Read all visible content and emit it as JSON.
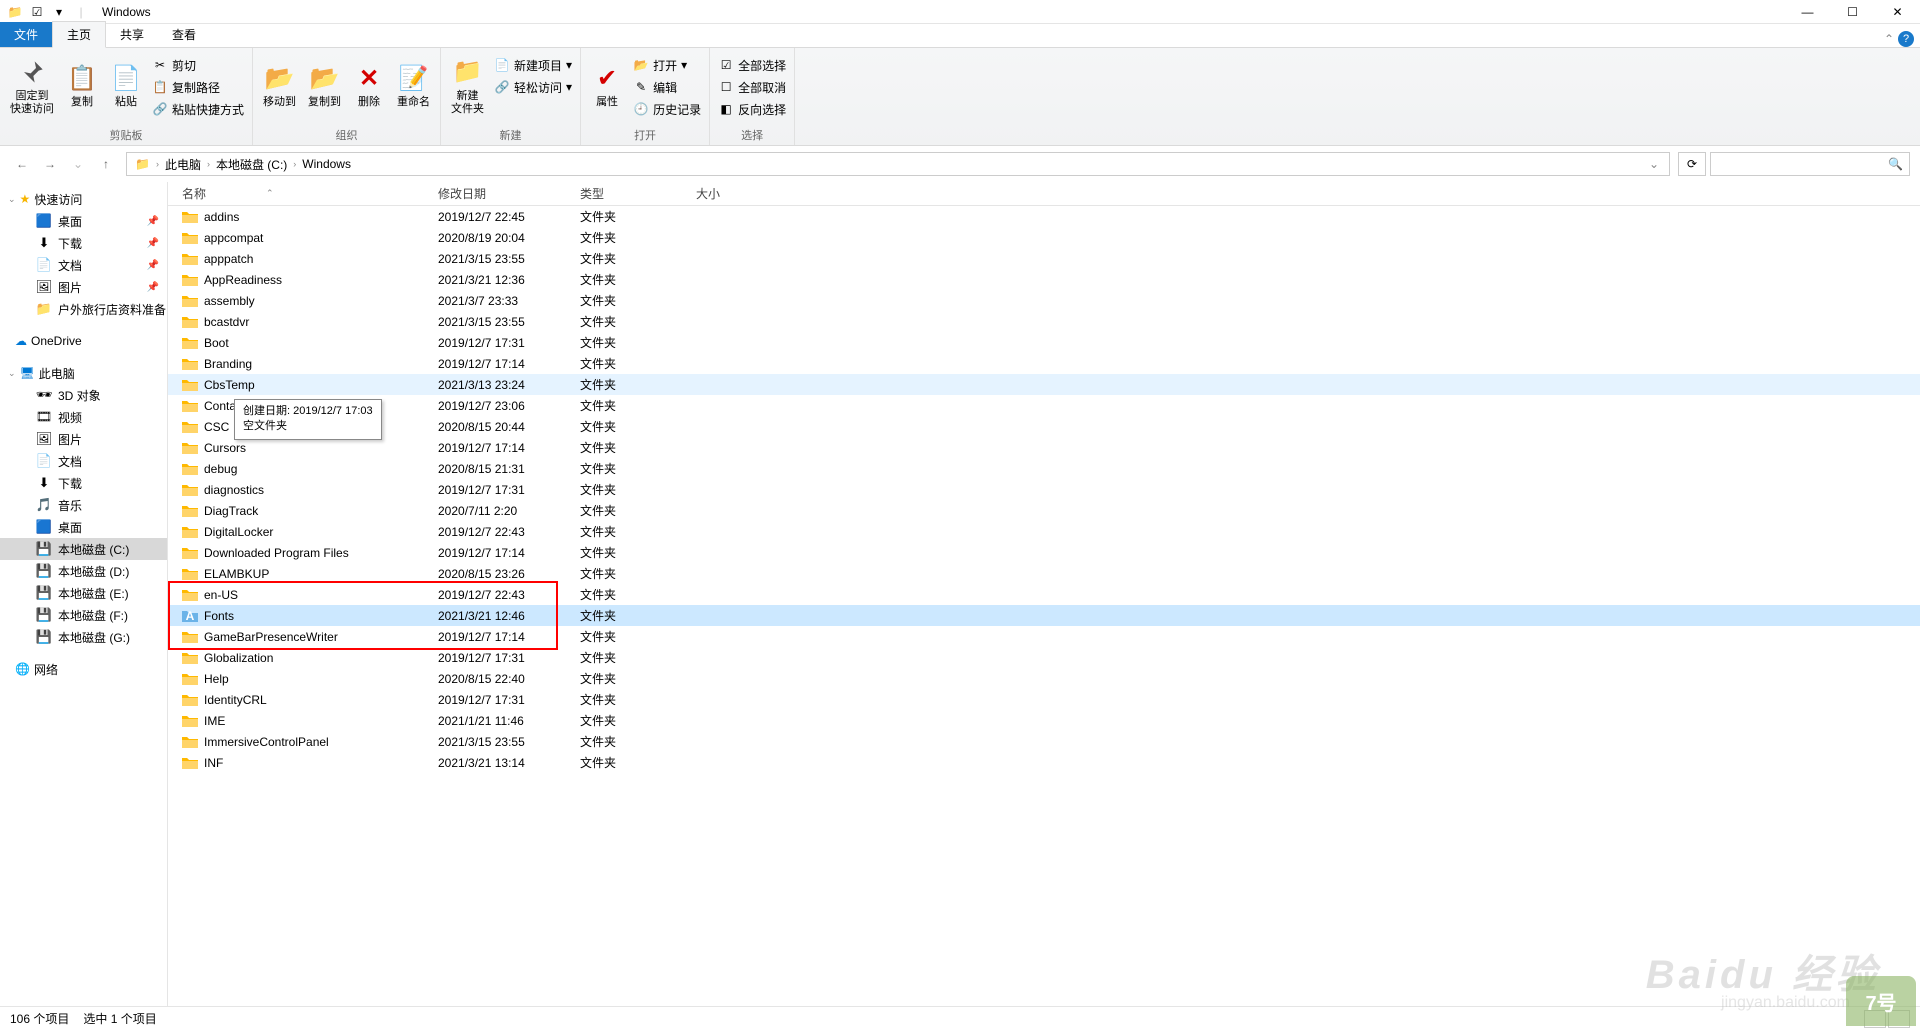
{
  "window": {
    "title": "Windows",
    "minimize": "—",
    "maximize": "☐",
    "close": "✕"
  },
  "tabs": {
    "file": "文件",
    "home": "主页",
    "share": "共享",
    "view": "查看"
  },
  "ribbon": {
    "clipboard": {
      "label": "剪贴板",
      "pin": "固定到\n快速访问",
      "copy": "复制",
      "paste": "粘贴",
      "cut": "剪切",
      "copy_path": "复制路径",
      "paste_shortcut": "粘贴快捷方式"
    },
    "organize": {
      "label": "组织",
      "move_to": "移动到",
      "copy_to": "复制到",
      "delete": "删除",
      "rename": "重命名"
    },
    "new": {
      "label": "新建",
      "new_folder": "新建\n文件夹",
      "new_item": "新建项目",
      "easy_access": "轻松访问"
    },
    "open": {
      "label": "打开",
      "properties": "属性",
      "open": "打开",
      "edit": "编辑",
      "history": "历史记录"
    },
    "select": {
      "label": "选择",
      "select_all": "全部选择",
      "select_none": "全部取消",
      "invert": "反向选择"
    }
  },
  "breadcrumbs": [
    "此电脑",
    "本地磁盘 (C:)",
    "Windows"
  ],
  "columns": {
    "name": "名称",
    "date": "修改日期",
    "type": "类型",
    "size": "大小"
  },
  "sidebar": {
    "quick_access": "快速访问",
    "quick_items": [
      {
        "icon": "🟦",
        "label": "桌面",
        "pinned": true
      },
      {
        "icon": "⬇",
        "label": "下载",
        "pinned": true
      },
      {
        "icon": "📄",
        "label": "文档",
        "pinned": true
      },
      {
        "icon": "🖼",
        "label": "图片",
        "pinned": true
      },
      {
        "icon": "📁",
        "label": "户外旅行店资料准备",
        "pinned": false
      }
    ],
    "onedrive": "OneDrive",
    "this_pc": "此电脑",
    "pc_items": [
      {
        "icon": "🕶",
        "label": "3D 对象"
      },
      {
        "icon": "🎞",
        "label": "视频"
      },
      {
        "icon": "🖼",
        "label": "图片"
      },
      {
        "icon": "📄",
        "label": "文档"
      },
      {
        "icon": "⬇",
        "label": "下载"
      },
      {
        "icon": "🎵",
        "label": "音乐"
      },
      {
        "icon": "🟦",
        "label": "桌面"
      },
      {
        "icon": "💾",
        "label": "本地磁盘 (C:)",
        "selected": true
      },
      {
        "icon": "💾",
        "label": "本地磁盘 (D:)"
      },
      {
        "icon": "💾",
        "label": "本地磁盘 (E:)"
      },
      {
        "icon": "💾",
        "label": "本地磁盘 (F:)"
      },
      {
        "icon": "💾",
        "label": "本地磁盘 (G:)"
      }
    ],
    "network": "网络"
  },
  "files": [
    {
      "name": "addins",
      "date": "2019/12/7 22:45",
      "type": "文件夹"
    },
    {
      "name": "appcompat",
      "date": "2020/8/19 20:04",
      "type": "文件夹"
    },
    {
      "name": "apppatch",
      "date": "2021/3/15 23:55",
      "type": "文件夹"
    },
    {
      "name": "AppReadiness",
      "date": "2021/3/21 12:36",
      "type": "文件夹"
    },
    {
      "name": "assembly",
      "date": "2021/3/7 23:33",
      "type": "文件夹"
    },
    {
      "name": "bcastdvr",
      "date": "2021/3/15 23:55",
      "type": "文件夹"
    },
    {
      "name": "Boot",
      "date": "2019/12/7 17:31",
      "type": "文件夹"
    },
    {
      "name": "Branding",
      "date": "2019/12/7 17:14",
      "type": "文件夹"
    },
    {
      "name": "CbsTemp",
      "date": "2021/3/13 23:24",
      "type": "文件夹",
      "hover": true
    },
    {
      "name": "Containers",
      "date": "2019/12/7 23:06",
      "type": "文件夹"
    },
    {
      "name": "CSC",
      "date": "2020/8/15 20:44",
      "type": "文件夹"
    },
    {
      "name": "Cursors",
      "date": "2019/12/7 17:14",
      "type": "文件夹"
    },
    {
      "name": "debug",
      "date": "2020/8/15 21:31",
      "type": "文件夹"
    },
    {
      "name": "diagnostics",
      "date": "2019/12/7 17:31",
      "type": "文件夹"
    },
    {
      "name": "DiagTrack",
      "date": "2020/7/11 2:20",
      "type": "文件夹"
    },
    {
      "name": "DigitalLocker",
      "date": "2019/12/7 22:43",
      "type": "文件夹"
    },
    {
      "name": "Downloaded Program Files",
      "date": "2019/12/7 17:14",
      "type": "文件夹"
    },
    {
      "name": "ELAMBKUP",
      "date": "2020/8/15 23:26",
      "type": "文件夹"
    },
    {
      "name": "en-US",
      "date": "2019/12/7 22:43",
      "type": "文件夹"
    },
    {
      "name": "Fonts",
      "date": "2021/3/21 12:46",
      "type": "文件夹",
      "selected": true,
      "fonts": true
    },
    {
      "name": "GameBarPresenceWriter",
      "date": "2019/12/7 17:14",
      "type": "文件夹"
    },
    {
      "name": "Globalization",
      "date": "2019/12/7 17:31",
      "type": "文件夹"
    },
    {
      "name": "Help",
      "date": "2020/8/15 22:40",
      "type": "文件夹"
    },
    {
      "name": "IdentityCRL",
      "date": "2019/12/7 17:31",
      "type": "文件夹"
    },
    {
      "name": "IME",
      "date": "2021/1/21 11:46",
      "type": "文件夹"
    },
    {
      "name": "ImmersiveControlPanel",
      "date": "2021/3/15 23:55",
      "type": "文件夹"
    },
    {
      "name": "INF",
      "date": "2021/3/21 13:14",
      "type": "文件夹"
    }
  ],
  "tooltip": "创建日期: 2019/12/7 17:03\n空文件夹",
  "status": {
    "count": "106 个项目",
    "selected": "选中 1 个项目"
  },
  "overlay": {
    "red_box_start": 18,
    "red_box_end": 20
  },
  "watermark": {
    "main": "Baidu 经验",
    "sub": "jingyan.baidu.com",
    "badge": "7号"
  }
}
